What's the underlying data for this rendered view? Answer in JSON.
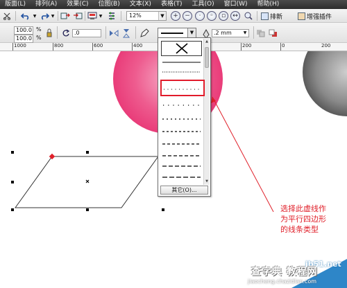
{
  "menubar": {
    "items": [
      "版面(L)",
      "排列(A)",
      "效果(C)",
      "位图(B)",
      "文本(X)",
      "表格(T)",
      "工具(O)",
      "窗口(W)",
      "帮助(H)"
    ]
  },
  "toolbar1": {
    "zoom": "12%",
    "sort_label": "排新",
    "plugin_label": "增强插件"
  },
  "toolbar2": {
    "size_w": "100.0",
    "size_h": "100.0",
    "unit": "%",
    "angle": ".0",
    "outline_width": ".2 mm"
  },
  "ruler": {
    "labels": [
      "1000",
      "800",
      "600",
      "400",
      "200",
      "0",
      "200"
    ]
  },
  "dropdown": {
    "more_button": "其它(O)..."
  },
  "annotation": {
    "lines": [
      "选择此虚线作",
      "为平行四边形",
      "的线条类型"
    ]
  },
  "watermark": {
    "logo": "jb51.net",
    "site": "查字典 教程网",
    "url": "jiaocheng.chazidian.com"
  },
  "colors": {
    "highlight": "#e11b2a",
    "annotation": "#e0202a",
    "pink_object": "#ee4f86",
    "gray_object": "#6a6a6a"
  }
}
